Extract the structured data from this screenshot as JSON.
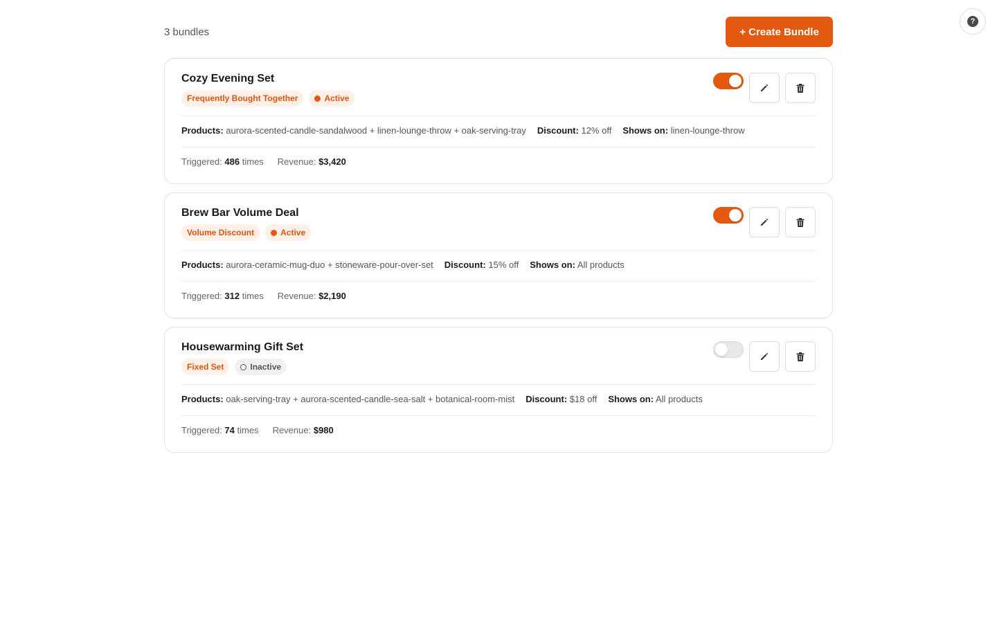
{
  "header": {
    "bundle_count": "3 bundles",
    "create_button": "+ Create Bundle",
    "help_glyph": "?"
  },
  "bundles": [
    {
      "title": "Cozy Evening Set",
      "type": "Frequently Bought Together",
      "status": "Active",
      "enabled": true,
      "products_label": "Products:",
      "products": "aurora-scented-candle-sandalwood + linen-lounge-throw + oak-serving-tray",
      "discount_label": "Discount:",
      "discount": "12% off",
      "shows_on_label": "Shows on:",
      "shows_on": "linen-lounge-throw",
      "triggered_label": "Triggered:",
      "triggered": "486",
      "triggered_unit": "times",
      "revenue_label": "Revenue:",
      "revenue": "$3,420"
    },
    {
      "title": "Brew Bar Volume Deal",
      "type": "Volume Discount",
      "status": "Active",
      "enabled": true,
      "products_label": "Products:",
      "products": "aurora-ceramic-mug-duo + stoneware-pour-over-set",
      "discount_label": "Discount:",
      "discount": "15% off",
      "shows_on_label": "Shows on:",
      "shows_on": "All products",
      "triggered_label": "Triggered:",
      "triggered": "312",
      "triggered_unit": "times",
      "revenue_label": "Revenue:",
      "revenue": "$2,190"
    },
    {
      "title": "Housewarming Gift Set",
      "type": "Fixed Set",
      "status": "Inactive",
      "enabled": false,
      "products_label": "Products:",
      "products": "oak-serving-tray + aurora-scented-candle-sea-salt + botanical-room-mist",
      "discount_label": "Discount:",
      "discount": "$18 off",
      "shows_on_label": "Shows on:",
      "shows_on": "All products",
      "triggered_label": "Triggered:",
      "triggered": "74",
      "triggered_unit": "times",
      "revenue_label": "Revenue:",
      "revenue": "$980"
    }
  ],
  "colors": {
    "accent": "#e2590f",
    "badge_bg": "#fdf0e8",
    "inactive_bg": "#f1f1f1"
  },
  "icons": {
    "help": "question-circle-icon",
    "edit": "pencil-icon",
    "delete": "trash-icon"
  }
}
